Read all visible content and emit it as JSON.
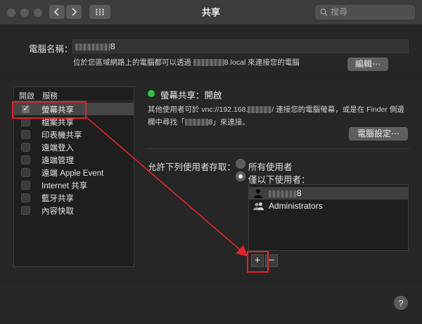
{
  "window": {
    "title": "共享"
  },
  "search": {
    "placeholder": "搜尋"
  },
  "computer_name": {
    "label": "電腦名稱：",
    "value_suffix": "8",
    "hint_prefix": "位於您區域網路上的電腦都可以透過",
    "hint_suffix": "8.local 來連接您的電腦",
    "edit_button": "編輯⋯"
  },
  "services": {
    "header_on": "開啟",
    "header_service": "服務",
    "items": [
      {
        "label": "螢幕共享",
        "checked": true,
        "selected": true
      },
      {
        "label": "檔案共享",
        "checked": false
      },
      {
        "label": "印表機共享",
        "checked": false
      },
      {
        "label": "遠端登入",
        "checked": false
      },
      {
        "label": "遠端管理",
        "checked": false
      },
      {
        "label": "遠端 Apple Event",
        "checked": false
      },
      {
        "label": "Internet 共享",
        "checked": false
      },
      {
        "label": "藍牙共享",
        "checked": false
      },
      {
        "label": "內容快取",
        "checked": false
      }
    ]
  },
  "detail": {
    "status": "螢幕共享：開啟",
    "status_color": "#2fc34a",
    "desc_line1_a": "其他使用者可於 vnc://192.168.",
    "desc_line1_b": "/ 連接您的電腦螢幕，或是在 Finder 側邊",
    "desc_line2_a": "欄中尋找「",
    "desc_line2_b": "8」來連接。",
    "computer_settings_button": "電腦設定⋯",
    "allow_label": "允許下列使用者存取：",
    "radio_all": "所有使用者",
    "radio_only": "僅以下使用者：",
    "users": [
      {
        "name_suffix": "8",
        "icon": "single-user-icon"
      },
      {
        "name": "Administrators",
        "icon": "group-users-icon"
      }
    ],
    "add_button": "+",
    "remove_button": "−"
  },
  "help": {
    "label": "?"
  },
  "annotation_color": "#e0242a"
}
